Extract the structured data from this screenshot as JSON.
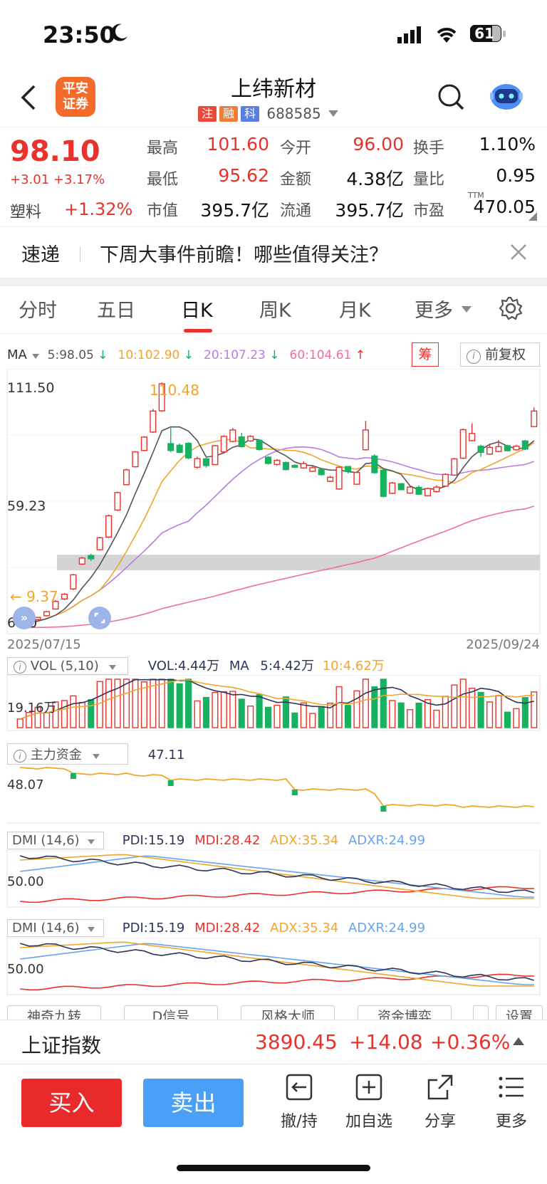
{
  "status": {
    "time": "23:50",
    "battery": "61"
  },
  "header": {
    "title": "上纬新材",
    "broker_logo": [
      "平安",
      "证券"
    ],
    "tags": [
      {
        "t": "注",
        "c": "#e8493b"
      },
      {
        "t": "融",
        "c": "#ef7e38"
      },
      {
        "t": "科",
        "c": "#5a7fe0"
      }
    ],
    "code": "688585"
  },
  "quote": {
    "price": "98.10",
    "change": "+3.01",
    "change_pct": "+3.17%",
    "sector": "塑料",
    "sector_pct": "+1.32%",
    "fields": [
      {
        "label": "最高",
        "value": "101.60",
        "color": "red"
      },
      {
        "label": "今开",
        "value": "96.00",
        "color": "red"
      },
      {
        "label": "换手",
        "value": "1.10%",
        "color": "dark"
      },
      {
        "label": "最低",
        "value": "95.62",
        "color": "red"
      },
      {
        "label": "金额",
        "value": "4.38亿",
        "color": "dark"
      },
      {
        "label": "量比",
        "value": "0.95",
        "color": "dark"
      },
      {
        "label": "市值",
        "value": "395.7亿",
        "color": "dark"
      },
      {
        "label": "流通",
        "value": "395.7亿",
        "color": "dark"
      },
      {
        "label": "市盈",
        "value": "470.05",
        "color": "dark"
      }
    ],
    "ttm": "TTM"
  },
  "news": {
    "label": "速递",
    "text": "下周大事件前瞻！哪些值得关注？"
  },
  "tabs": [
    "分时",
    "五日",
    "日K",
    "周K",
    "月K",
    "更多"
  ],
  "active_tab": 2,
  "ma_legend": {
    "ma": "MA",
    "items": [
      {
        "text": "5:98.05",
        "color": "#555555"
      },
      {
        "text": "10:102.90",
        "color": "#f0a52c"
      },
      {
        "text": "20:107.23",
        "color": "#b57ee0"
      },
      {
        "text": "60:104.61",
        "color": "#ee6fa0"
      }
    ],
    "chou": "筹",
    "fq": "前复权"
  },
  "chart_data": {
    "type": "candlestick",
    "x_start": "2025/07/15",
    "x_end": "2025/09/24",
    "y_ticks": [
      "111.50",
      "59.23",
      "6.00"
    ],
    "high_label": "110.48",
    "low_label": "9.37",
    "ylim": [
      6,
      112
    ],
    "candles": [
      [
        9.5,
        9.8,
        9.2,
        10
      ],
      [
        10.4,
        11.2,
        10.1,
        11.4
      ],
      [
        11.9,
        12.8,
        11.6,
        13
      ],
      [
        13.5,
        15.2,
        13.2,
        15.5
      ],
      [
        16.3,
        19.5,
        16,
        20
      ],
      [
        20.5,
        22.5,
        20,
        23
      ],
      [
        24.7,
        30.6,
        24.2,
        31
      ],
      [
        35.1,
        37.6,
        34.7,
        38.2
      ],
      [
        38.7,
        37.3,
        36.5,
        39.4
      ],
      [
        41.1,
        46.1,
        40.8,
        46.5
      ],
      [
        46.4,
        55.3,
        46,
        55.8
      ],
      [
        57.7,
        65,
        57.3,
        65.4
      ],
      [
        68.3,
        74.5,
        68,
        75
      ],
      [
        75.8,
        82,
        75.5,
        82.3
      ],
      [
        82.6,
        88.2,
        82.3,
        88.6
      ],
      [
        90.3,
        99.1,
        90,
        100
      ],
      [
        99.2,
        110.5,
        98.8,
        111
      ],
      [
        85.5,
        82.6,
        82,
        92
      ],
      [
        84.8,
        81.8,
        81.5,
        85.5
      ],
      [
        85.6,
        79.5,
        79,
        86
      ],
      [
        75.6,
        79.2,
        75,
        80
      ],
      [
        79.1,
        76.3,
        75.4,
        80
      ],
      [
        76.7,
        84.6,
        76.4,
        84.9
      ],
      [
        82,
        88.5,
        81.7,
        89
      ],
      [
        86.4,
        91.2,
        86,
        92
      ],
      [
        88.3,
        84.2,
        83.8,
        90
      ],
      [
        86.6,
        88.5,
        86.2,
        89
      ],
      [
        86.9,
        83,
        82.6,
        87.3
      ],
      [
        79.8,
        77.2,
        76.7,
        80.2
      ],
      [
        76.8,
        78.5,
        76.3,
        79
      ],
      [
        77.6,
        74.6,
        74.3,
        78
      ],
      [
        76.4,
        75.6,
        75.3,
        76.8
      ],
      [
        75.3,
        77.1,
        75,
        78
      ],
      [
        73.9,
        75.4,
        73.6,
        76
      ],
      [
        74.7,
        72.5,
        72,
        75
      ],
      [
        69.7,
        71.4,
        69.4,
        72
      ],
      [
        66.5,
        75.6,
        66.2,
        76
      ],
      [
        75.9,
        73.9,
        73,
        76
      ],
      [
        68.5,
        73.4,
        68.2,
        74
      ],
      [
        82.9,
        91.2,
        82.6,
        95
      ],
      [
        80.3,
        73.3,
        73,
        81
      ],
      [
        74.3,
        63.4,
        63,
        75
      ],
      [
        64.7,
        69,
        64.4,
        69.5
      ],
      [
        68.7,
        66.2,
        66,
        69
      ],
      [
        64.8,
        67.3,
        64.5,
        68
      ],
      [
        67.2,
        64.3,
        64,
        68
      ],
      [
        63.7,
        66.7,
        63.4,
        67
      ],
      [
        65.4,
        67.3,
        65,
        68
      ],
      [
        67.7,
        72.6,
        67.4,
        73
      ],
      [
        72.3,
        79.1,
        72,
        79.5
      ],
      [
        79.4,
        91.3,
        79,
        91.8
      ],
      [
        86.7,
        89.7,
        86.4,
        94
      ],
      [
        84.4,
        81.8,
        80,
        85
      ],
      [
        81.1,
        83.9,
        80.8,
        85.5
      ],
      [
        82.2,
        84.2,
        81.9,
        87
      ],
      [
        84.6,
        82.5,
        82.2,
        85
      ],
      [
        82.9,
        84.4,
        82.6,
        85
      ],
      [
        86.6,
        83.2,
        82.8,
        87
      ],
      [
        92.6,
        99.1,
        92.3,
        100.6
      ]
    ]
  },
  "zone": {
    "ylow": 32.5,
    "yhigh": 39.0
  },
  "vol": {
    "title": "VOL (5,10)",
    "value": "VOL:4.44万",
    "ma": "MA",
    "ma5": "5:4.42万",
    "ma10": "10:4.62万",
    "ytick": "19.16万"
  },
  "fund": {
    "title": "主力资金",
    "value": "47.11",
    "ytick": "48.07"
  },
  "dmi1": {
    "title": "DMI (14,6)",
    "pdi": "PDI:15.19",
    "mdi": "MDI:28.42",
    "adx": "ADX:35.34",
    "adxr": "ADXR:24.99",
    "ytick": "50.00"
  },
  "dmi2": {
    "title": "DMI (14,6)",
    "pdi": "PDI:15.19",
    "mdi": "MDI:28.42",
    "adx": "ADX:35.34",
    "adxr": "ADXR:24.99",
    "ytick": "50.00"
  },
  "chips": [
    "神奇九转",
    "D信号",
    "风格大师",
    "资金博弈",
    "",
    "设置"
  ],
  "index": {
    "name": "上证指数",
    "value": "3890.45",
    "change": "+14.08",
    "pct": "+0.36%"
  },
  "bottom": {
    "buy": "买入",
    "sell": "卖出",
    "actions": [
      "撤/持",
      "加自选",
      "分享",
      "更多"
    ]
  },
  "colors": {
    "red": "#e8322b",
    "green": "#16b260",
    "blue": "#4aa0f7"
  }
}
